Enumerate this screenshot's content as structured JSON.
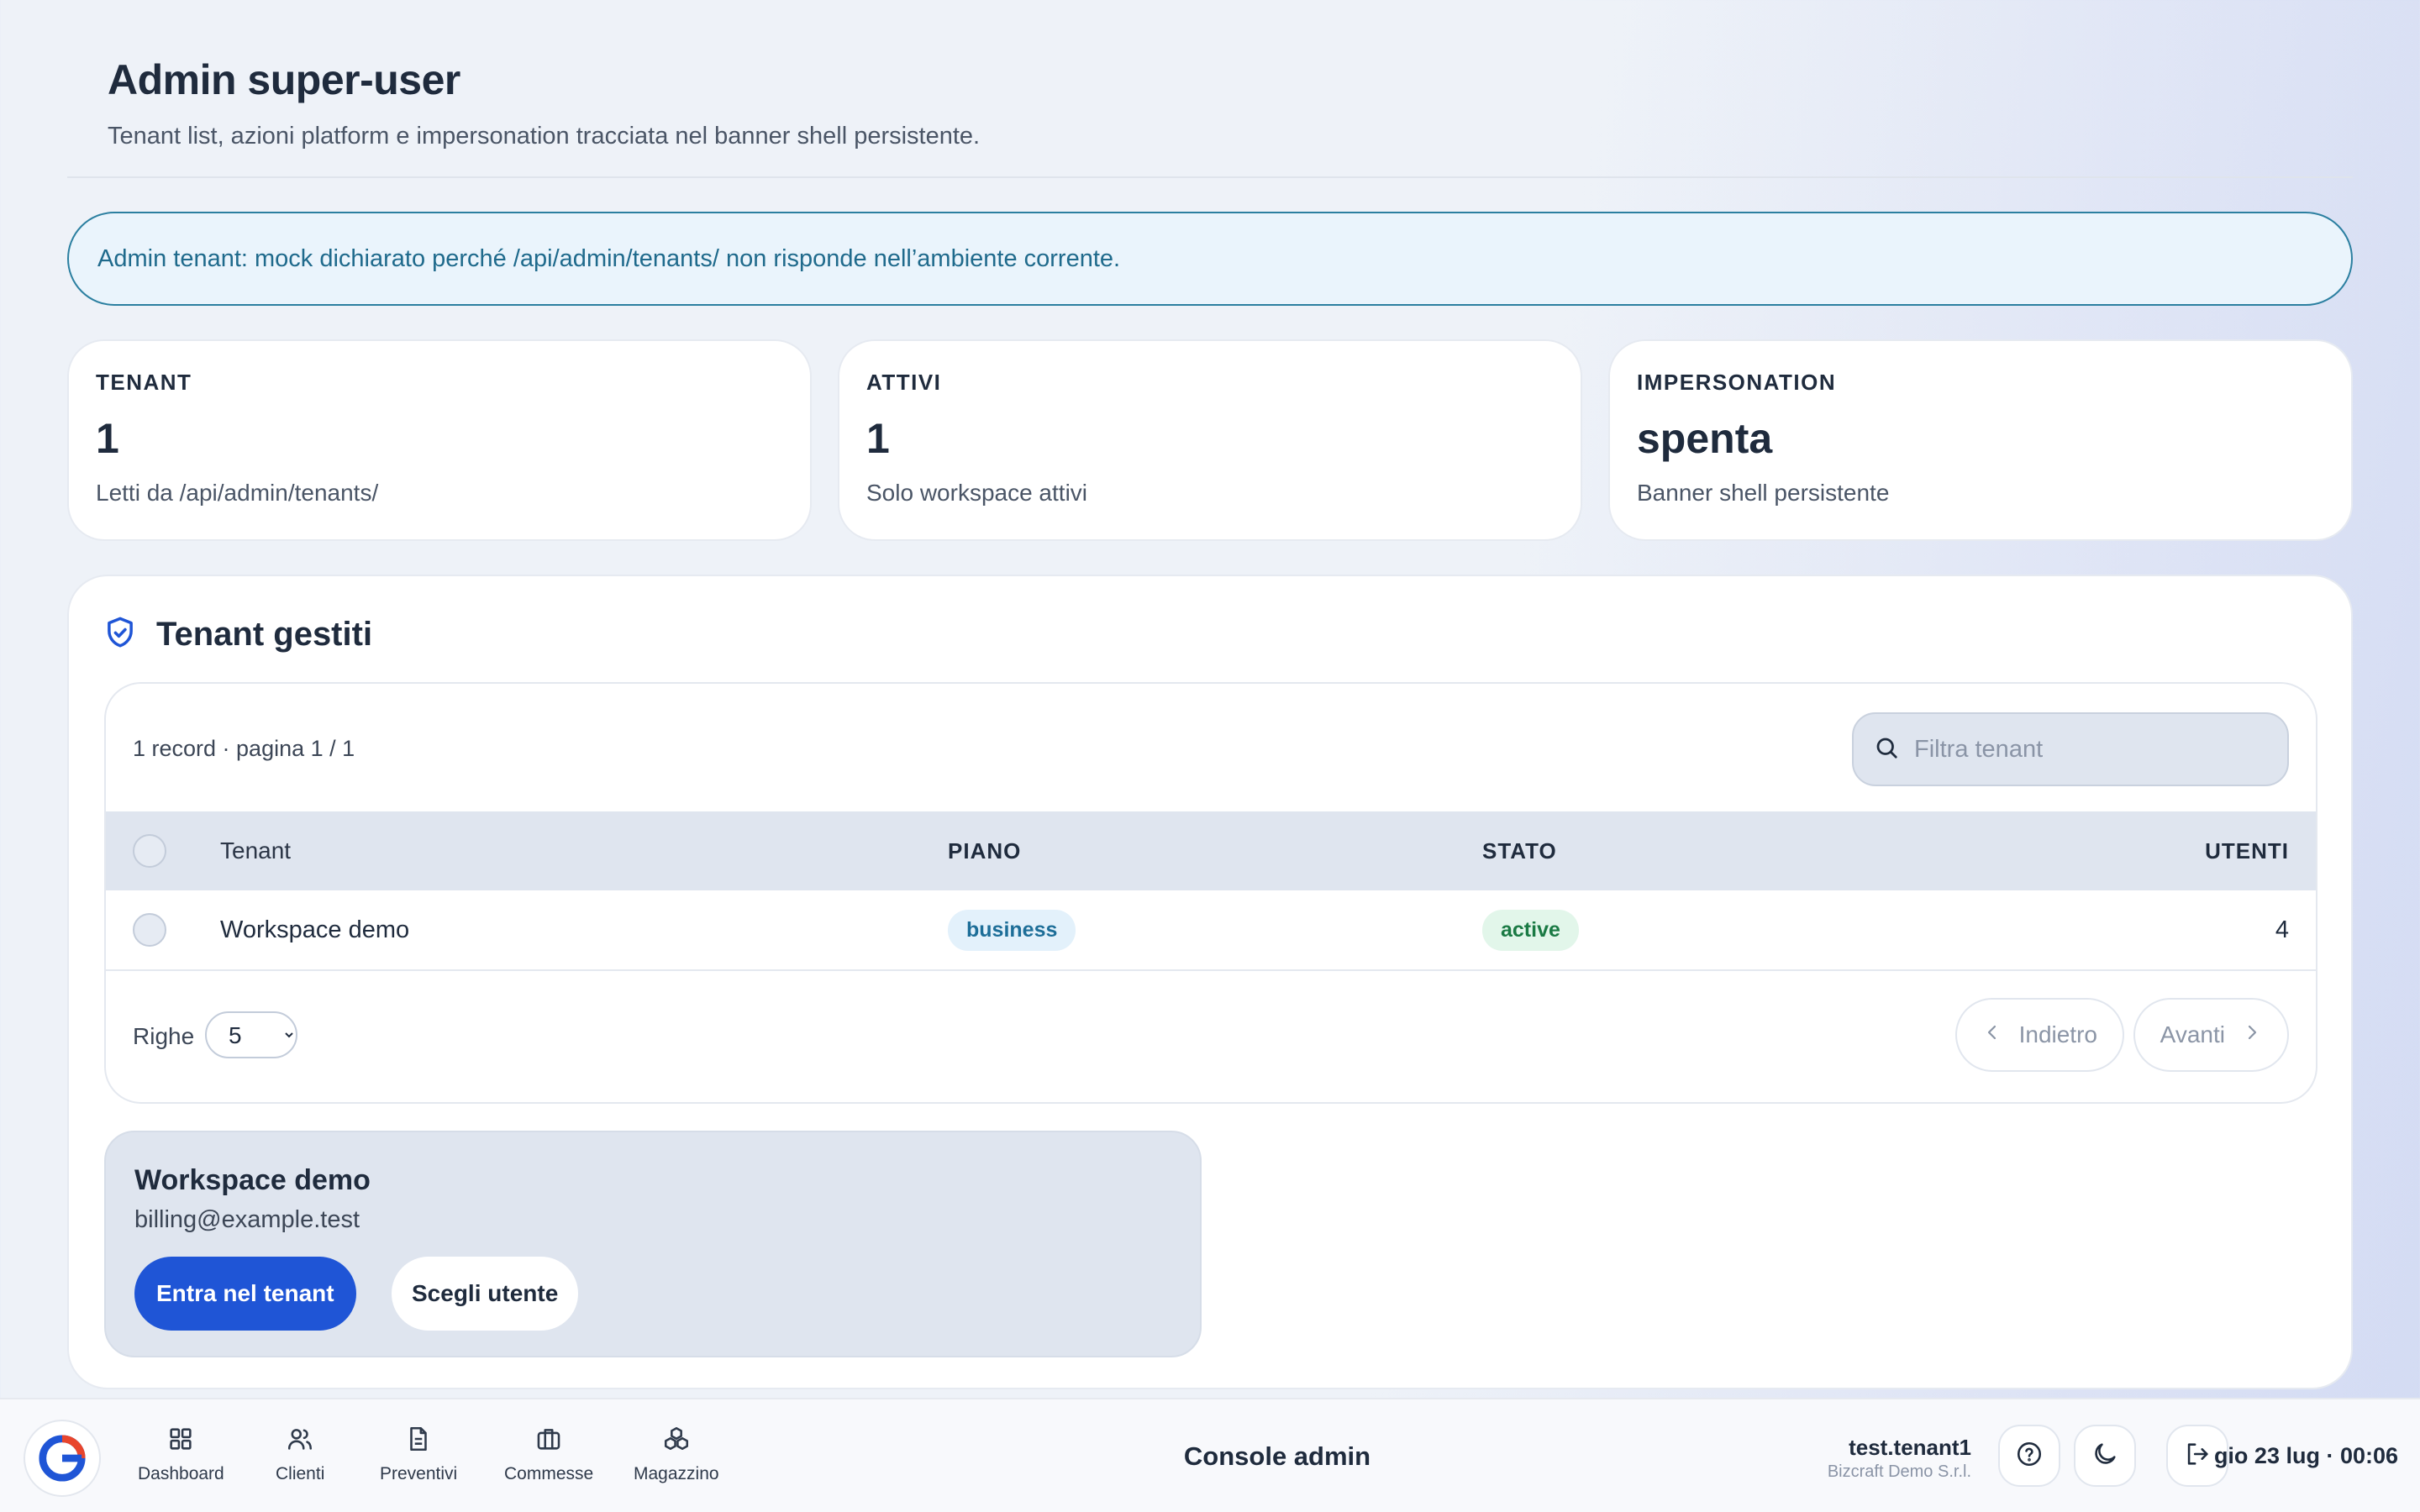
{
  "header": {
    "title": "Admin super-user",
    "subtitle": "Tenant list, azioni platform e impersonation tracciata nel banner shell persistente."
  },
  "notice": "Admin tenant: mock dichiarato perché /api/admin/tenants/ non risponde nell’ambiente corrente.",
  "stats": [
    {
      "label": "TENANT",
      "value": "1",
      "note": "Letti da /api/admin/tenants/"
    },
    {
      "label": "ATTIVI",
      "value": "1",
      "note": "Solo workspace attivi"
    },
    {
      "label": "IMPERSONATION",
      "value": "spenta",
      "note": "Banner shell persistente"
    }
  ],
  "panel": {
    "title": "Tenant gestiti",
    "icon": "shield-check-icon",
    "meta": "1 record · pagina 1 / 1",
    "search_placeholder": "Filtra tenant",
    "columns": {
      "tenant": "Tenant",
      "piano": "PIANO",
      "stato": "STATO",
      "utenti": "UTENTI"
    },
    "rows": [
      {
        "tenant": "Workspace demo",
        "piano": "business",
        "stato": "active",
        "utenti": "4"
      }
    ],
    "rows_label": "Righe",
    "rows_options": [
      "5"
    ],
    "rows_selected": "5",
    "prev_label": "Indietro",
    "next_label": "Avanti"
  },
  "detail": {
    "title": "Workspace demo",
    "email": "billing@example.test",
    "primary_label": "Entra nel tenant",
    "secondary_label": "Scegli utente"
  },
  "bottombar": {
    "nav": [
      {
        "label": "Dashboard",
        "icon": "dashboard-grid-icon"
      },
      {
        "label": "Clienti",
        "icon": "users-icon"
      },
      {
        "label": "Preventivi",
        "icon": "document-icon"
      },
      {
        "label": "Commesse",
        "icon": "briefcase-icon"
      },
      {
        "label": "Magazzino",
        "icon": "boxes-icon"
      }
    ],
    "center_title": "Console admin",
    "user_name": "test.tenant1",
    "user_org": "Bizcraft Demo S.r.l.",
    "clock": "gio 23 lug · 00:06"
  },
  "colors": {
    "accent": "#1f55d6",
    "notice_border": "#2b7fa0",
    "plan_badge": "#1d6e98",
    "status_badge": "#1a7a44"
  }
}
